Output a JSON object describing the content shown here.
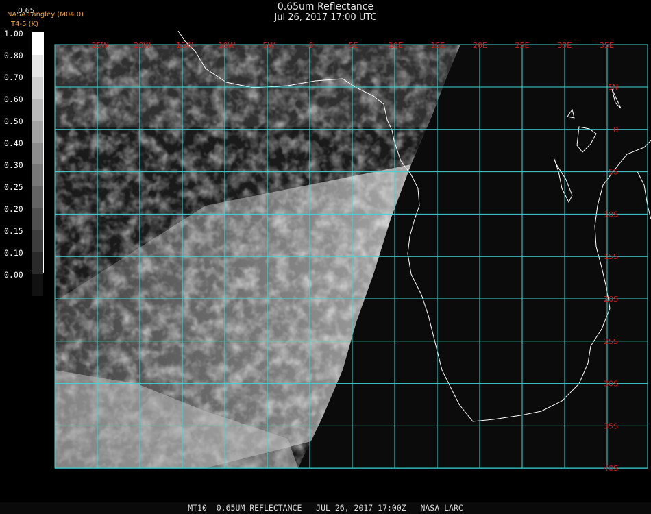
{
  "title": "0.65um Reflectance",
  "subtitle": "Jul 26, 2017 17:00 UTC",
  "credit": "NASA Langley (M04.0)",
  "credit_unit": "T4-5 (K)",
  "scale_top": "0.65",
  "colorbar": {
    "labels": [
      "1.00",
      "0.80",
      "0.70",
      "0.60",
      "0.50",
      "0.40",
      "0.30",
      "0.25",
      "0.20",
      "0.15",
      "0.10",
      "0.00"
    ],
    "colors": [
      "#ffffff",
      "#e6e6e6",
      "#cfcfcf",
      "#b8b8b8",
      "#a2a2a2",
      "#8c8c8c",
      "#777777",
      "#636363",
      "#505050",
      "#3d3d3d",
      "#2a2a2a",
      "#111111"
    ]
  },
  "map": {
    "lon_labels": [
      "25W",
      "20W",
      "15W",
      "10W",
      "5W",
      "0",
      "5E",
      "10E",
      "15E",
      "20E",
      "25E",
      "30E",
      "35E"
    ],
    "lat_labels": [
      "5N",
      "0",
      "5S",
      "10S",
      "15S",
      "20S",
      "25S",
      "30S",
      "35S",
      "40S"
    ],
    "grid_color": "#3fd6d6",
    "label_color": "#d21d1d"
  },
  "footer": "MT10  0.65UM REFLECTANCE   JUL 26, 2017 17:00Z   NASA LARC"
}
